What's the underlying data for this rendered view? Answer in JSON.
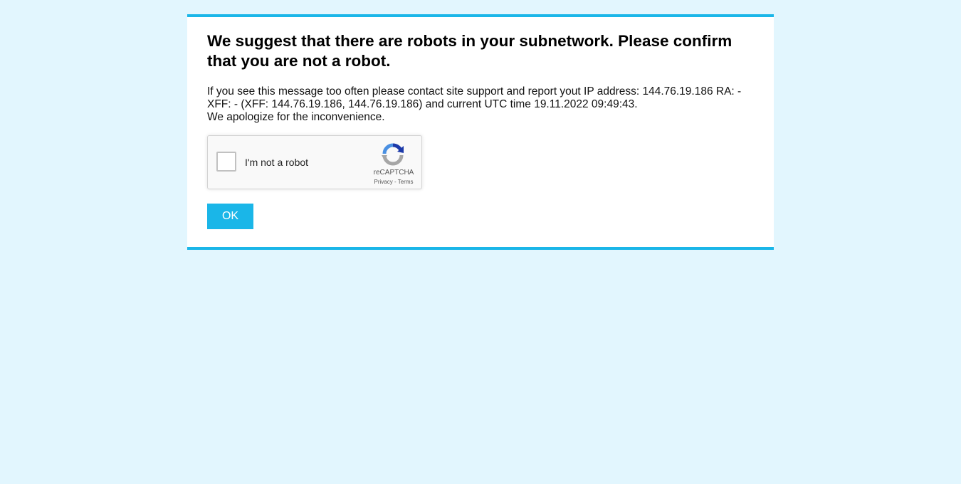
{
  "page": {
    "title": "We suggest that there are robots in your subnetwork. Please confirm that you are not a robot.",
    "message_line1": "If you see this message too often please contact site support and report yout IP address: 144.76.19.186 RA: -XFF: - (XFF: 144.76.19.186, 144.76.19.186) and current UTC time 19.11.2022 09:49:43.",
    "message_line2": "We apologize for the inconvenience.",
    "ok_label": "OK"
  },
  "recaptcha": {
    "checkbox_label": "I'm not a robot",
    "brand": "reCAPTCHA",
    "privacy_label": "Privacy",
    "separator": " - ",
    "terms_label": "Terms",
    "icon": "recaptcha-logo"
  },
  "colors": {
    "background": "#e2f6fe",
    "accent": "#1ab6e8",
    "card": "#ffffff"
  }
}
